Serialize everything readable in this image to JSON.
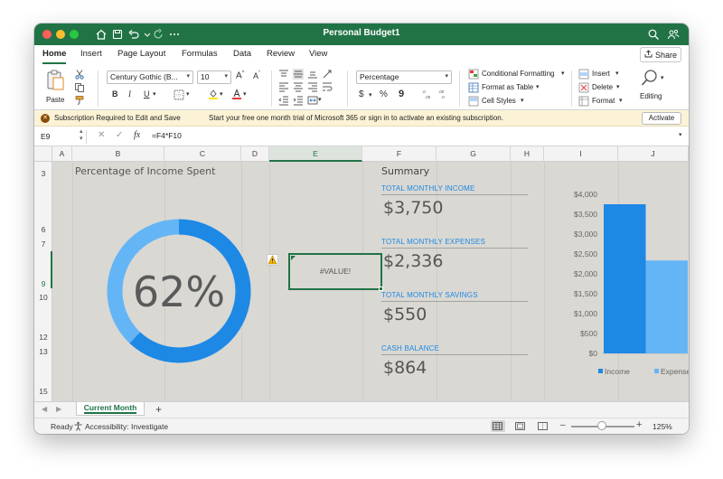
{
  "app": {
    "document_title": "Personal Budget1",
    "colors": {
      "brand": "#217346",
      "accent_blue": "#1e88e5",
      "light_blue": "#64b5f6",
      "sheet_bg": "#d9d8d3"
    }
  },
  "tabs": [
    "Home",
    "Insert",
    "Page Layout",
    "Formulas",
    "Data",
    "Review",
    "View"
  ],
  "share_label": "Share",
  "ribbon": {
    "paste_label": "Paste",
    "font_name": "Century Gothic (B...",
    "font_size": "10",
    "bold": "B",
    "italic": "I",
    "underline": "U",
    "grow_font": "A",
    "shrink_font": "A",
    "number_format": "Percentage",
    "currency_symbol": "$",
    "percent_symbol": "%",
    "comma_symbol": "9",
    "conditional_formatting": "Conditional Formatting",
    "format_as_table": "Format as Table",
    "cell_styles": "Cell Styles",
    "insert": "Insert",
    "delete": "Delete",
    "format": "Format",
    "editing": "Editing"
  },
  "message_bar": {
    "bold_text": "Subscription Required to Edit and Save",
    "text": "Start your free one month trial of Microsoft 365 or sign in to activate an existing subscription.",
    "button": "Activate"
  },
  "formula_bar": {
    "name_box": "E9",
    "fx": "fx",
    "formula": "=F4*F10"
  },
  "columns": [
    "A",
    "B",
    "C",
    "D",
    "E",
    "F",
    "G",
    "H",
    "I",
    "J"
  ],
  "rows": [
    "3",
    "6",
    "7",
    "9",
    "10",
    "12",
    "13",
    "15"
  ],
  "sheet": {
    "title": "Percentage of Income Spent",
    "percent_display": "62%",
    "percent_value": 0.62,
    "error_cell": "#VALUE!",
    "summary_title": "Summary",
    "items": [
      {
        "label": "TOTAL MONTHLY INCOME",
        "value": "$3,750"
      },
      {
        "label": "TOTAL MONTHLY EXPENSES",
        "value": "$2,336"
      },
      {
        "label": "TOTAL MONTHLY SAVINGS",
        "value": "$550"
      },
      {
        "label": "CASH BALANCE",
        "value": "$864"
      }
    ]
  },
  "chart_data": {
    "type": "bar",
    "categories": [
      ""
    ],
    "series": [
      {
        "name": "Income",
        "values": [
          3750
        ],
        "color": "#1e88e5"
      },
      {
        "name": "Expenses",
        "values": [
          2336
        ],
        "color": "#64b5f6"
      }
    ],
    "ylim": [
      0,
      4000
    ],
    "yticks": [
      "$0",
      "$500",
      "$1,000",
      "$1,500",
      "$2,000",
      "$2,500",
      "$3,000",
      "$3,500",
      "$4,000"
    ],
    "ytick_values": [
      0,
      500,
      1000,
      1500,
      2000,
      2500,
      3000,
      3500,
      4000
    ],
    "grid": false,
    "legend_position": "bottom"
  },
  "sheet_tabs": [
    {
      "label": "Current Month",
      "active": true
    }
  ],
  "status": {
    "ready": "Ready",
    "accessibility": "Accessibility: Investigate",
    "zoom": "125%"
  }
}
